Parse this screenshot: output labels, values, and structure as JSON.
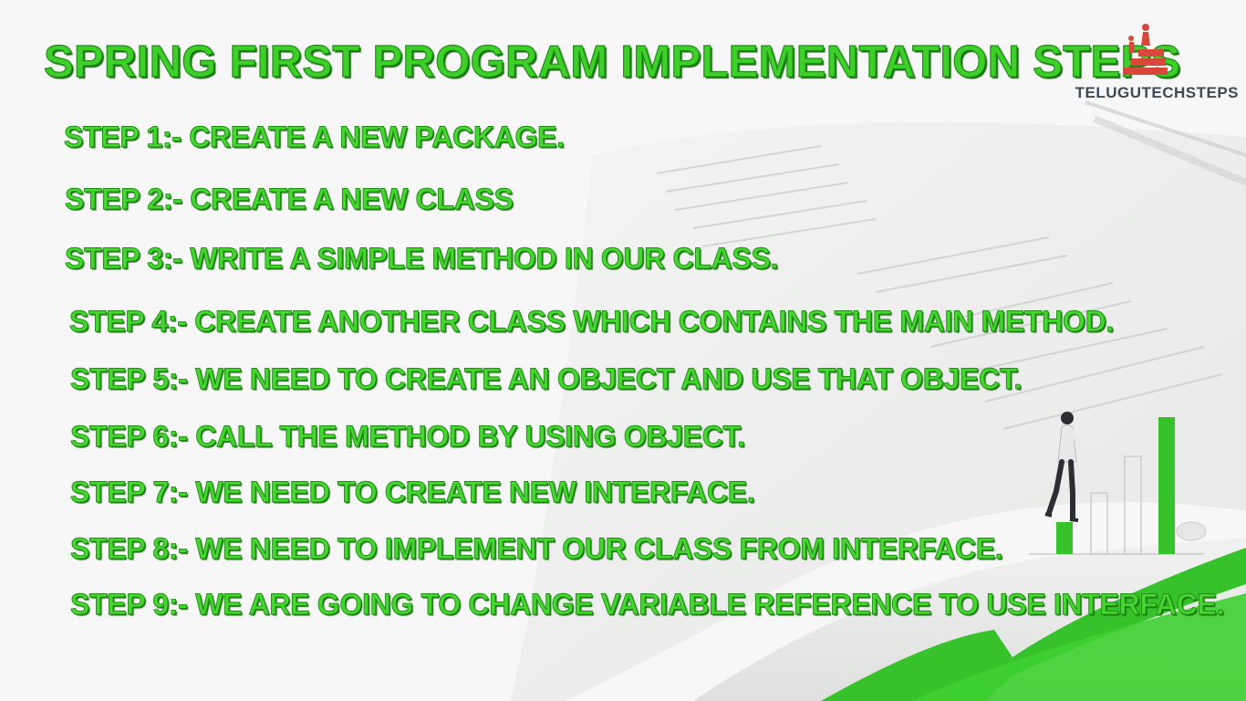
{
  "title": "SPRING FIRST PROGRAM IMPLEMENTATION STEPS",
  "brand": {
    "name": "TELUGUTECHSTEPS"
  },
  "steps": [
    "STEP 1:- CREATE A NEW PACKAGE.",
    "STEP 2:- CREATE A NEW CLASS",
    "STEP 3:- WRITE A SIMPLE METHOD IN OUR CLASS.",
    "STEP 4:- CREATE ANOTHER CLASS WHICH CONTAINS THE MAIN METHOD.",
    "STEP 5:- WE NEED TO CREATE AN OBJECT AND USE THAT OBJECT.",
    "STEP 6:- CALL THE METHOD BY USING OBJECT.",
    "STEP 7:- WE NEED TO CREATE NEW INTERFACE.",
    "STEP 8:- WE NEED TO IMPLEMENT OUR CLASS FROM INTERFACE.",
    "STEP 9:- WE ARE GOING TO CHANGE VARIABLE REFERENCE TO USE INTERFACE."
  ],
  "colors": {
    "accent": "#45d630",
    "accent_dark": "#1f8f14",
    "brand_text": "#404a55",
    "logo_red": "#d9473a"
  }
}
